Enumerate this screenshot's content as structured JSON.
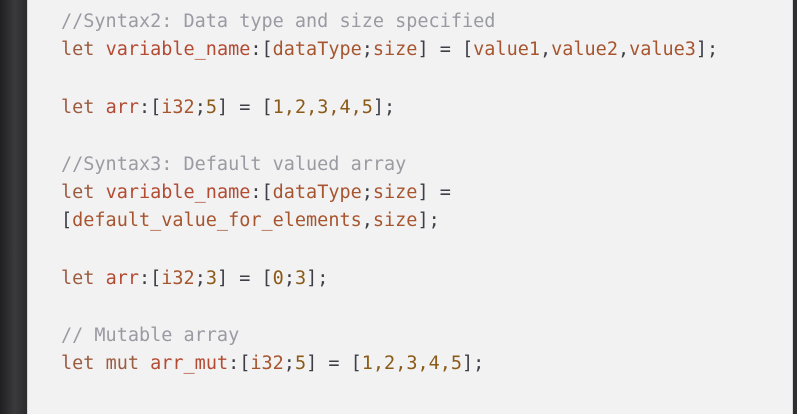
{
  "code": {
    "lines": {
      "c1": "//Syntax2: Data type and size specified",
      "l1": {
        "kw": "let",
        "name": "variable_name",
        "p1": ":[",
        "type": "dataType",
        "p2": ";",
        "size": "size",
        "p3": "] = [",
        "v1": "value1",
        "c1": ",",
        "v2": "value2",
        "c2": ",",
        "v3": "value3",
        "end": "];"
      },
      "l2": {
        "kw": "let",
        "name": "arr",
        "p1": ":[",
        "type": "i32",
        "p2": ";",
        "size": "5",
        "p3": "] = [",
        "vals": "1,2,3,4,5",
        "end": "];"
      },
      "c3": "//Syntax3: Default valued array",
      "l3": {
        "kw": "let",
        "name": "variable_name",
        "p1": ":[",
        "type": "dataType",
        "p2": ";",
        "size": "size",
        "end": "] ="
      },
      "l3b": {
        "p0": "[",
        "arg1": "default_value_for_elements",
        "comma": ",",
        "arg2": "size",
        "end": "];"
      },
      "l4": {
        "kw": "let",
        "name": "arr",
        "p1": ":[",
        "type": "i32",
        "p2": ";",
        "size": "3",
        "p3": "] = [",
        "v1": "0",
        "semi": ";",
        "v2": "3",
        "end": "];"
      },
      "c5": "// Mutable array",
      "l5": {
        "kw": "let",
        "mut": "mut",
        "name": "arr_mut",
        "p1": ":[",
        "type": "i32",
        "p2": ";",
        "size": "5",
        "p3": "] = [",
        "vals": "1,2,3,4,5",
        "end": "];"
      }
    }
  },
  "colors": {
    "background": "#f2f2f3",
    "comment": "#9a9aa2",
    "keyword": "#9b5c40",
    "identifier": "#b34a32",
    "number": "#8a5a18"
  }
}
